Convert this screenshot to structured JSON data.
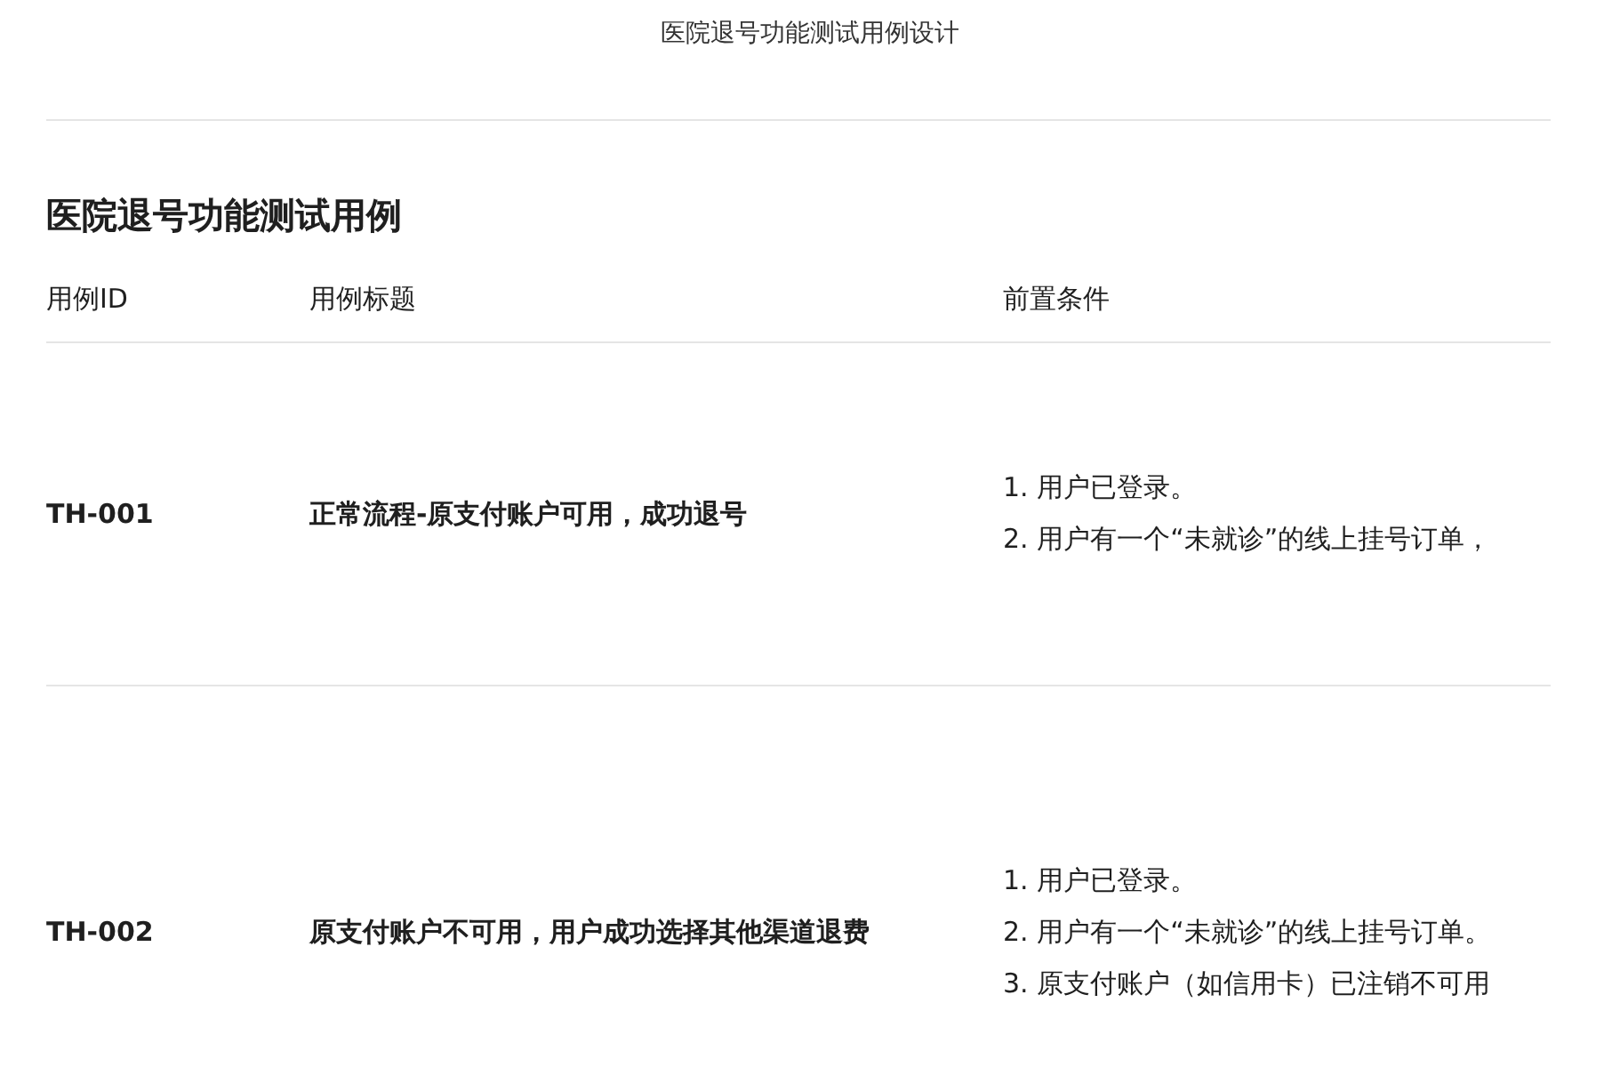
{
  "page_title": "医院退号功能测试用例设计",
  "heading": "医院退号功能测试用例",
  "table": {
    "columns": [
      "用例ID",
      "用例标题",
      "前置条件"
    ],
    "rows": [
      {
        "id": "TH-001",
        "title": "正常流程-原支付账户可用，成功退号",
        "preconditions": [
          "1. 用户已登录。",
          "2. 用户有一个“未就诊”的线上挂号订单，"
        ]
      },
      {
        "id": "TH-002",
        "title": "原支付账户不可用，用户成功选择其他渠道退费",
        "preconditions": [
          "1. 用户已登录。",
          "2. 用户有一个“未就诊”的线上挂号订单。",
          "3. 原支付账户（如信用卡）已注销不可用"
        ]
      }
    ]
  }
}
